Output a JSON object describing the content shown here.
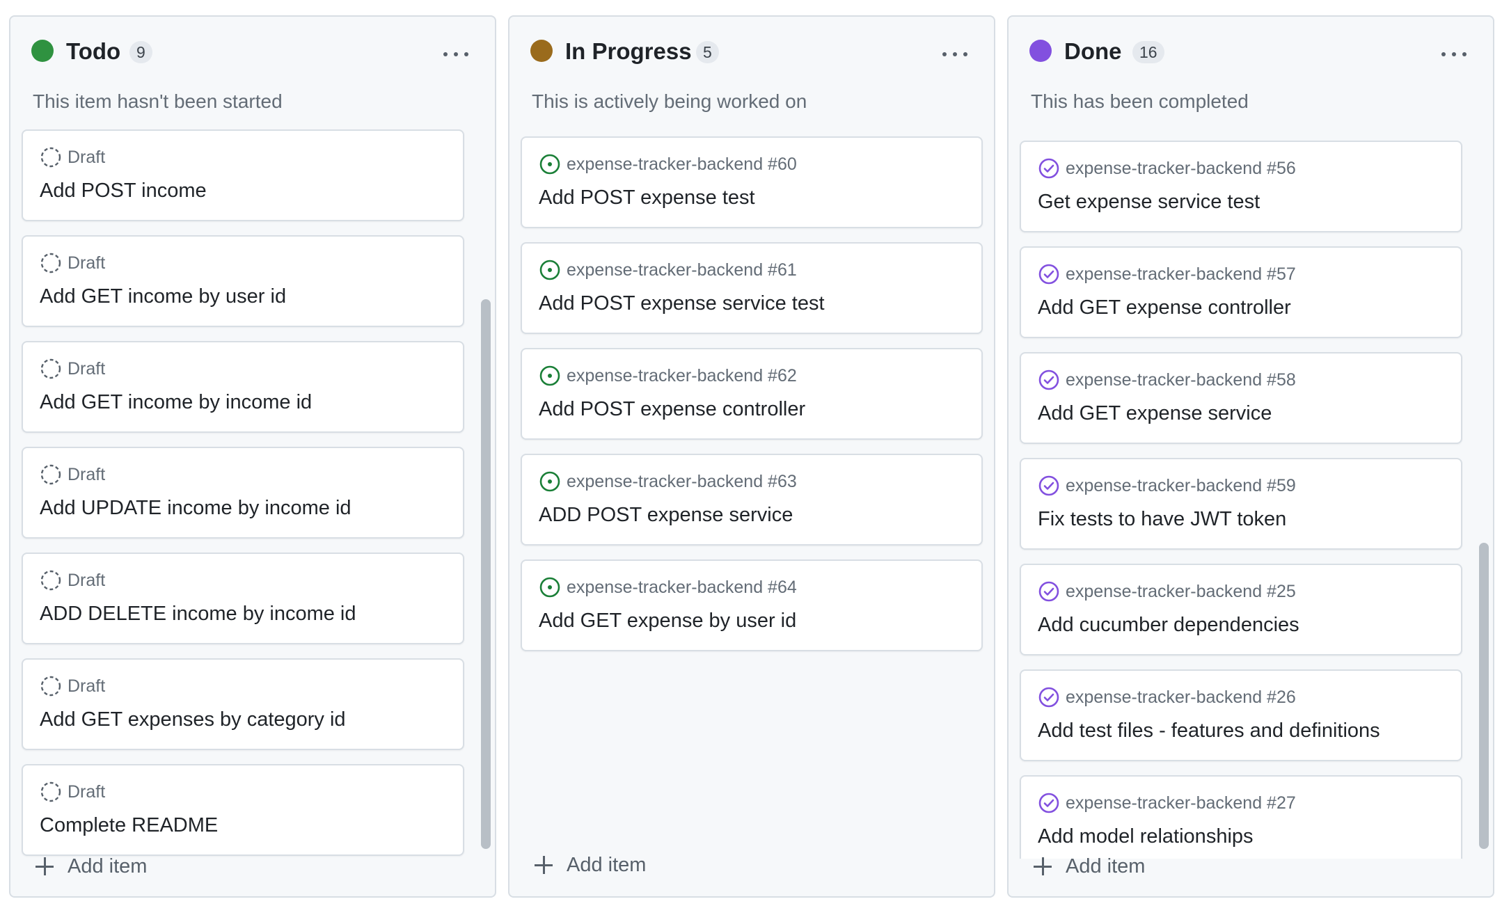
{
  "colors": {
    "todo": "#2f9240",
    "in_progress": "#9a6b1c",
    "done": "#8250df",
    "open_issue": "#1a7f37",
    "closed_issue": "#8250df",
    "draft": "#57606a"
  },
  "columns": [
    {
      "key": "todo",
      "title": "Todo",
      "count": "9",
      "description": "This item hasn't been started",
      "add_label": "Add item",
      "cards": [
        {
          "meta": "Draft",
          "title": "Add POST income",
          "icon": "draft-icon"
        },
        {
          "meta": "Draft",
          "title": "Add GET income by user id",
          "icon": "draft-icon"
        },
        {
          "meta": "Draft",
          "title": "Add GET income by income id",
          "icon": "draft-icon"
        },
        {
          "meta": "Draft",
          "title": "Add UPDATE income by income id",
          "icon": "draft-icon"
        },
        {
          "meta": "Draft",
          "title": "ADD DELETE income by income id",
          "icon": "draft-icon"
        },
        {
          "meta": "Draft",
          "title": "Add GET expenses by category id",
          "icon": "draft-icon"
        },
        {
          "meta": "Draft",
          "title": "Complete README",
          "icon": "draft-icon"
        }
      ]
    },
    {
      "key": "in_progress",
      "title": "In Progress",
      "count": "5",
      "description": "This is actively being worked on",
      "add_label": "Add item",
      "cards": [
        {
          "meta": "expense-tracker-backend #60",
          "title": "Add POST expense test",
          "icon": "open-issue-icon"
        },
        {
          "meta": "expense-tracker-backend #61",
          "title": "Add POST expense service test",
          "icon": "open-issue-icon"
        },
        {
          "meta": "expense-tracker-backend #62",
          "title": "Add POST expense controller",
          "icon": "open-issue-icon"
        },
        {
          "meta": "expense-tracker-backend #63",
          "title": "ADD POST expense service",
          "icon": "open-issue-icon"
        },
        {
          "meta": "expense-tracker-backend #64",
          "title": "Add GET expense by user id",
          "icon": "open-issue-icon"
        }
      ]
    },
    {
      "key": "done",
      "title": "Done",
      "count": "16",
      "description": "This has been completed",
      "add_label": "Add item",
      "cards": [
        {
          "meta": "expense-tracker-backend #56",
          "title": "Get expense service test",
          "icon": "closed-issue-icon"
        },
        {
          "meta": "expense-tracker-backend #57",
          "title": "Add GET expense controller",
          "icon": "closed-issue-icon"
        },
        {
          "meta": "expense-tracker-backend #58",
          "title": "Add GET expense service",
          "icon": "closed-issue-icon"
        },
        {
          "meta": "expense-tracker-backend #59",
          "title": "Fix tests to have JWT token",
          "icon": "closed-issue-icon"
        },
        {
          "meta": "expense-tracker-backend #25",
          "title": "Add cucumber dependencies",
          "icon": "closed-issue-icon"
        },
        {
          "meta": "expense-tracker-backend #26",
          "title": "Add test files - features and definitions",
          "icon": "closed-issue-icon"
        },
        {
          "meta": "expense-tracker-backend #27",
          "title": "Add model relationships",
          "icon": "closed-issue-icon"
        }
      ]
    }
  ]
}
